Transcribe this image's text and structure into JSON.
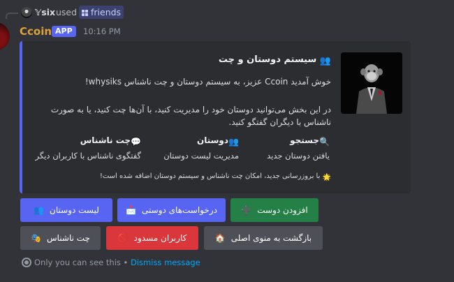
{
  "command": {
    "user": "𝕐six",
    "used_text": "used",
    "command_name": "friends"
  },
  "message": {
    "bot_name": "Ccoin",
    "badge": "APP",
    "timestamp": "10:16 PM"
  },
  "embed": {
    "accent_color": "#5865f2",
    "title_emoji": "👥",
    "title": "سیستم دوستان و چت",
    "welcome_line": "خوش آمدید Ccoin عزیز، به سیستم دوستان و چت ناشناس whysiks!",
    "desc_line1": "در این بخش می‌توانید دوستان خود را مدیریت کنید، با آن‌ها چت کنید، یا به صورت",
    "desc_line2": "ناشناس با دیگران گفتگو کنید.",
    "fields": [
      {
        "emoji": "🔍",
        "name": "جستجو",
        "value": "یافتن دوستان جدید"
      },
      {
        "emoji": "👥",
        "name": "دوستان",
        "value": "مدیریت لیست دوستان"
      },
      {
        "emoji": "💬",
        "name": "چت ناشناس",
        "value": "گفتگوی ناشناس با کاربران دیگر"
      }
    ],
    "footer_emoji": "🌟",
    "footer": "با بروزرسانی جدید، امکان چت ناشناس و سیستم دوستان اضافه شده است!"
  },
  "buttons": {
    "row1": [
      {
        "label": "افزودن دوست",
        "emoji": "➕",
        "style": "green"
      },
      {
        "label": "درخواست‌های دوستی",
        "emoji": "📩",
        "style": "blurple"
      },
      {
        "label": "لیست دوستان",
        "emoji": "👥",
        "style": "blurple"
      }
    ],
    "row2": [
      {
        "label": "بازگشت به منوی اصلی",
        "emoji": "🏠",
        "style": "grey"
      },
      {
        "label": "کاربران مسدود",
        "emoji": "🚫",
        "style": "red"
      },
      {
        "label": "چت ناشناس",
        "emoji": "🎭",
        "style": "grey"
      }
    ]
  },
  "ephemeral": {
    "text": "Only you can see this",
    "separator": "•",
    "dismiss": "Dismiss message"
  }
}
